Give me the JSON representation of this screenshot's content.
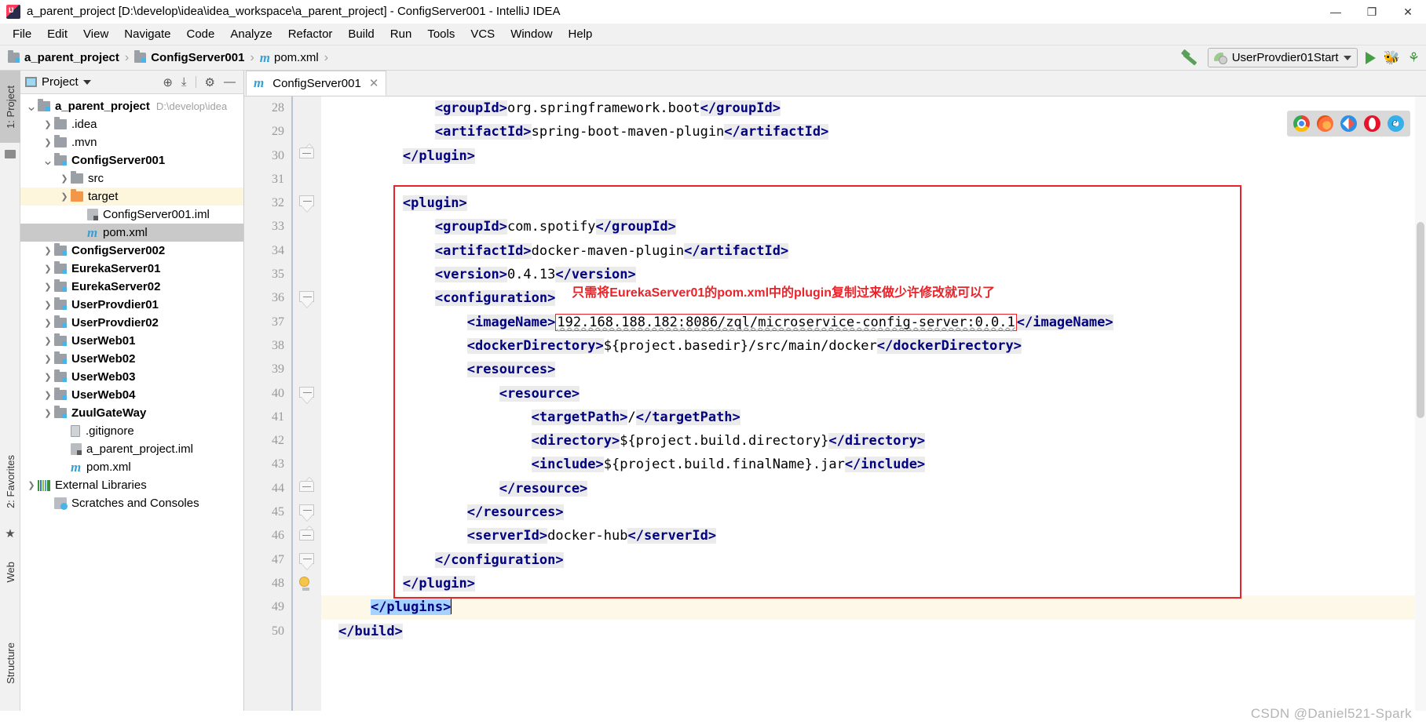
{
  "window": {
    "title": "a_parent_project [D:\\develop\\idea\\idea_workspace\\a_parent_project] - ConfigServer001 - IntelliJ IDEA",
    "app_icon": "intellij-idea-icon",
    "controls": {
      "minimize": "—",
      "maximize": "❐",
      "close": "✕"
    }
  },
  "menubar": {
    "items": [
      {
        "label": "File"
      },
      {
        "label": "Edit"
      },
      {
        "label": "View"
      },
      {
        "label": "Navigate"
      },
      {
        "label": "Code"
      },
      {
        "label": "Analyze"
      },
      {
        "label": "Refactor"
      },
      {
        "label": "Build"
      },
      {
        "label": "Run"
      },
      {
        "label": "Tools"
      },
      {
        "label": "VCS"
      },
      {
        "label": "Window"
      },
      {
        "label": "Help"
      }
    ]
  },
  "navbar": {
    "breadcrumbs": [
      {
        "label": "a_parent_project",
        "icon": "module-folder-icon",
        "bold": true
      },
      {
        "label": "ConfigServer001",
        "icon": "module-folder-icon",
        "bold": true
      },
      {
        "label": "pom.xml",
        "icon": "maven-m-icon",
        "bold": false
      }
    ],
    "separator": "›",
    "build_icon": "hammer-icon",
    "run_config": "UserProvdier01Start",
    "run_icon": "run-triangle-icon",
    "debug_icon": "debug-bug-icon",
    "run_coverage_icon": "run-with-coverage-icon"
  },
  "left_tool_strip": {
    "tabs": [
      {
        "label": "1: Project",
        "active": true
      },
      {
        "label": "2: Favorites",
        "active": false
      },
      {
        "label": "Web",
        "active": false
      },
      {
        "label": "Structure",
        "active": false
      }
    ]
  },
  "project_panel": {
    "title": "Project",
    "dropdown_icon": "chevron-down-icon",
    "tools": [
      {
        "name": "locate-icon",
        "glyph": "⊕"
      },
      {
        "name": "collapse-all-icon",
        "glyph": "⤓"
      },
      {
        "name": "settings-gear-icon",
        "glyph": "⚙"
      },
      {
        "name": "hide-panel-icon",
        "glyph": "—"
      }
    ],
    "tree": [
      {
        "label": "a_parent_project",
        "path": "D:\\develop\\idea",
        "indent": 0,
        "arrow": "v",
        "icon": "module-folder",
        "bold": true,
        "state": "none"
      },
      {
        "label": ".idea",
        "indent": 1,
        "arrow": ">",
        "icon": "plain-folder",
        "bold": false,
        "state": "none"
      },
      {
        "label": ".mvn",
        "indent": 1,
        "arrow": ">",
        "icon": "plain-folder",
        "bold": false,
        "state": "none"
      },
      {
        "label": "ConfigServer001",
        "indent": 1,
        "arrow": "v",
        "icon": "module-folder",
        "bold": true,
        "state": "none"
      },
      {
        "label": "src",
        "indent": 2,
        "arrow": ">",
        "icon": "plain-folder",
        "bold": false,
        "state": "none"
      },
      {
        "label": "target",
        "indent": 2,
        "arrow": ">",
        "icon": "orange-folder",
        "bold": false,
        "state": "highlight"
      },
      {
        "label": "ConfigServer001.iml",
        "indent": 3,
        "arrow": "",
        "icon": "iml-file",
        "bold": false,
        "state": "none"
      },
      {
        "label": "pom.xml",
        "indent": 3,
        "arrow": "",
        "icon": "maven-m",
        "bold": false,
        "state": "selected"
      },
      {
        "label": "ConfigServer002",
        "indent": 1,
        "arrow": ">",
        "icon": "module-folder",
        "bold": true,
        "state": "none"
      },
      {
        "label": "EurekaServer01",
        "indent": 1,
        "arrow": ">",
        "icon": "module-folder",
        "bold": true,
        "state": "none"
      },
      {
        "label": "EurekaServer02",
        "indent": 1,
        "arrow": ">",
        "icon": "module-folder",
        "bold": true,
        "state": "none"
      },
      {
        "label": "UserProvdier01",
        "indent": 1,
        "arrow": ">",
        "icon": "module-folder",
        "bold": true,
        "state": "none"
      },
      {
        "label": "UserProvdier02",
        "indent": 1,
        "arrow": ">",
        "icon": "module-folder",
        "bold": true,
        "state": "none"
      },
      {
        "label": "UserWeb01",
        "indent": 1,
        "arrow": ">",
        "icon": "module-folder",
        "bold": true,
        "state": "none"
      },
      {
        "label": "UserWeb02",
        "indent": 1,
        "arrow": ">",
        "icon": "module-folder",
        "bold": true,
        "state": "none"
      },
      {
        "label": "UserWeb03",
        "indent": 1,
        "arrow": ">",
        "icon": "module-folder",
        "bold": true,
        "state": "none"
      },
      {
        "label": "UserWeb04",
        "indent": 1,
        "arrow": ">",
        "icon": "module-folder",
        "bold": true,
        "state": "none"
      },
      {
        "label": "ZuulGateWay",
        "indent": 1,
        "arrow": ">",
        "icon": "module-folder",
        "bold": true,
        "state": "none"
      },
      {
        "label": ".gitignore",
        "indent": 2,
        "arrow": "",
        "icon": "git-file",
        "bold": false,
        "state": "none"
      },
      {
        "label": "a_parent_project.iml",
        "indent": 2,
        "arrow": "",
        "icon": "iml-file",
        "bold": false,
        "state": "none"
      },
      {
        "label": "pom.xml",
        "indent": 2,
        "arrow": "",
        "icon": "maven-m",
        "bold": false,
        "state": "none"
      },
      {
        "label": "External Libraries",
        "indent": 0,
        "arrow": ">",
        "icon": "library",
        "bold": false,
        "state": "none"
      },
      {
        "label": "Scratches and Consoles",
        "indent": 1,
        "arrow": "",
        "icon": "scratches",
        "bold": false,
        "state": "none"
      }
    ]
  },
  "editor": {
    "tabs": [
      {
        "label": "ConfigServer001",
        "icon": "maven-m-icon",
        "close": "✕",
        "active": true
      }
    ],
    "first_line_number": 28,
    "lines": [
      {
        "n": 28,
        "text": "            <groupId>org.springframework.boot</groupId>"
      },
      {
        "n": 29,
        "text": "            <artifactId>spring-boot-maven-plugin</artifactId>"
      },
      {
        "n": 30,
        "text": "        </plugin>"
      },
      {
        "n": 31,
        "text": ""
      },
      {
        "n": 32,
        "text": "        <plugin>"
      },
      {
        "n": 33,
        "text": "            <groupId>com.spotify</groupId>"
      },
      {
        "n": 34,
        "text": "            <artifactId>docker-maven-plugin</artifactId>"
      },
      {
        "n": 35,
        "text": "            <version>0.4.13</version>"
      },
      {
        "n": 36,
        "text": "            <configuration>"
      },
      {
        "n": 37,
        "text": "                <imageName>192.168.188.182:8086/zql/microservice-config-server:0.0.1</imageName>"
      },
      {
        "n": 38,
        "text": "                <dockerDirectory>${project.basedir}/src/main/docker</dockerDirectory>"
      },
      {
        "n": 39,
        "text": "                <resources>"
      },
      {
        "n": 40,
        "text": "                    <resource>"
      },
      {
        "n": 41,
        "text": "                        <targetPath>/</targetPath>"
      },
      {
        "n": 42,
        "text": "                        <directory>${project.build.directory}</directory>"
      },
      {
        "n": 43,
        "text": "                        <include>${project.build.finalName}.jar</include>"
      },
      {
        "n": 44,
        "text": "                    </resource>"
      },
      {
        "n": 45,
        "text": "                </resources>"
      },
      {
        "n": 46,
        "text": "                <serverId>docker-hub</serverId>"
      },
      {
        "n": 47,
        "text": "            </configuration>"
      },
      {
        "n": 48,
        "text": "        </plugin>"
      },
      {
        "n": 49,
        "text": "    </plugins>"
      },
      {
        "n": 50,
        "text": "</build>"
      }
    ],
    "selected_text": "</plugins>",
    "current_line": 49,
    "intention_bulb_icon": "lightbulb-icon"
  },
  "annotations": {
    "note_text": "只需将EurekaServer01的pom.xml中的plugin复制过来做少许修改就可以了",
    "note_color": "#e8232a",
    "highlight_box_color": "#e8232a",
    "image_name_value": "192.168.188.182:8086/zql/microservice-config-server:0.0.1"
  },
  "browser_popup": {
    "icons": [
      {
        "name": "chrome-icon"
      },
      {
        "name": "firefox-icon"
      },
      {
        "name": "safari-icon"
      },
      {
        "name": "opera-icon"
      },
      {
        "name": "internet-explorer-icon"
      }
    ]
  },
  "watermark": "CSDN @Daniel521-Spark"
}
